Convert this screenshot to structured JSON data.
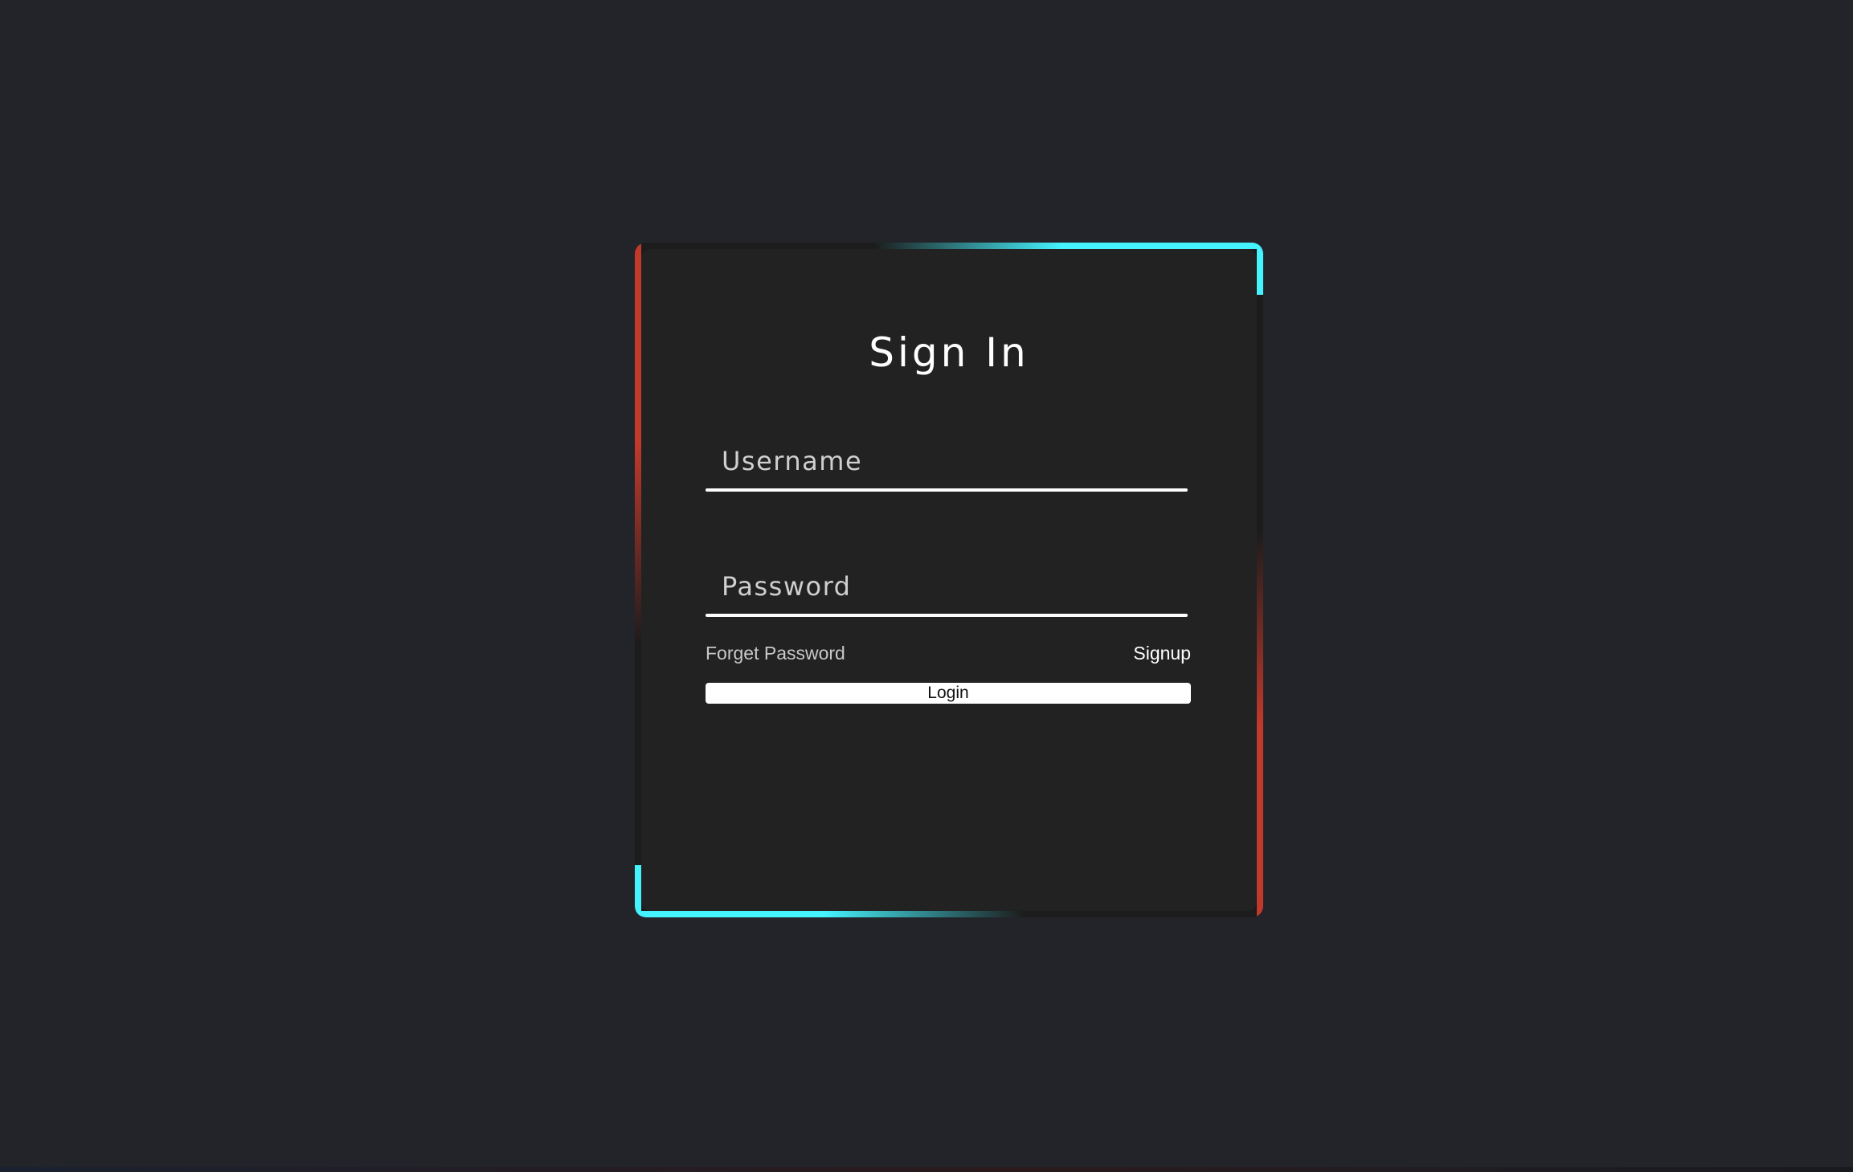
{
  "form": {
    "title": "Sign In",
    "username_placeholder": "Username",
    "password_placeholder": "Password",
    "forgot_password_label": "Forget Password",
    "signup_label": "Signup",
    "login_label": "Login"
  },
  "colors": {
    "background": "#23242a",
    "card": "#222222",
    "accent_cyan": "#45f3ff",
    "accent_red": "#c0392b"
  }
}
